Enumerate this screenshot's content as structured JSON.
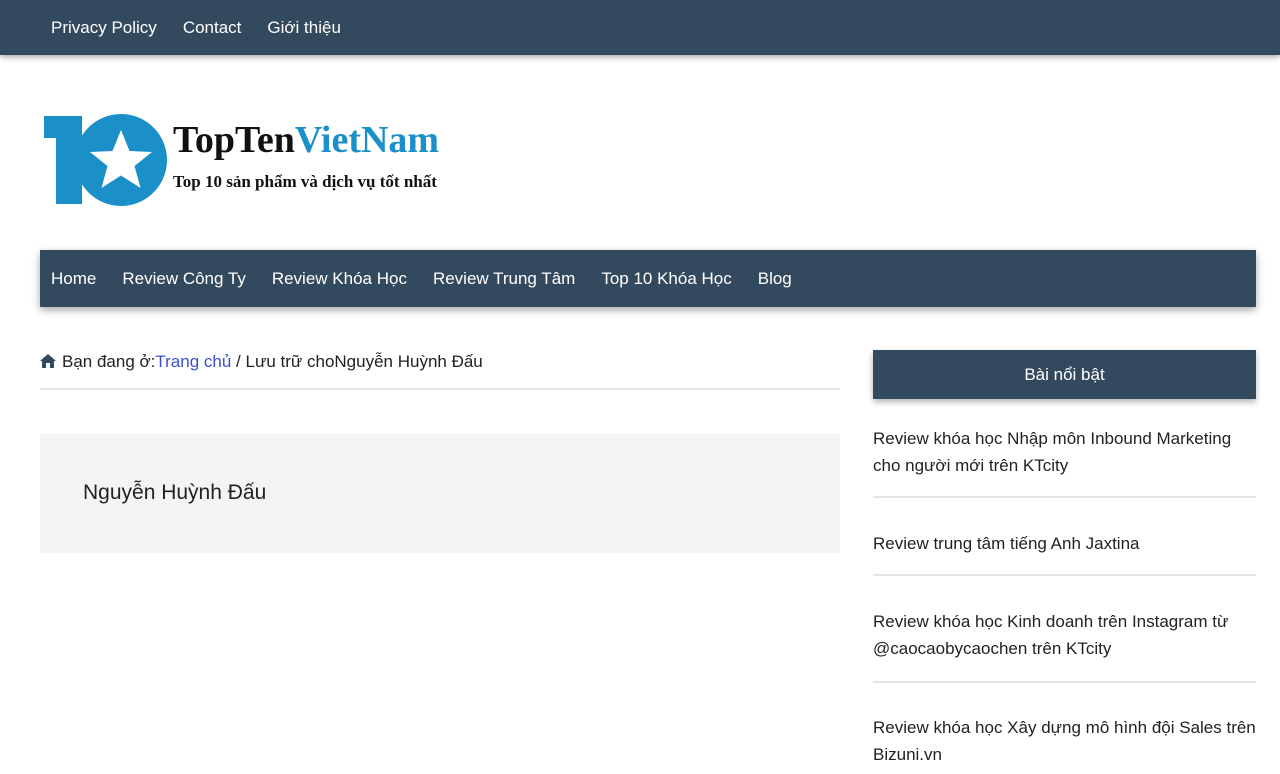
{
  "top_nav": {
    "items": [
      "Privacy Policy",
      "Contact",
      "Giới thiệu"
    ]
  },
  "logo": {
    "title_part1": "TopTen",
    "title_part2": "VietNam",
    "tagline": "Top 10 sản phẩm và dịch vụ tốt nhất",
    "colors": {
      "brand_blue": "#1b8fc8",
      "dark": "#111111"
    }
  },
  "main_nav": {
    "items": [
      "Home",
      "Review Công Ty",
      "Review Khóa Học",
      "Review Trung Tâm",
      "Top 10 Khóa Học",
      "Blog"
    ]
  },
  "breadcrumb": {
    "icon": "home-icon",
    "prefix": "Bạn đang ở:",
    "home_link": "Trang chủ",
    "separator": " / ",
    "current": "Lưu trữ choNguyễn Huỳnh Đấu"
  },
  "archive": {
    "title": "Nguyễn Huỳnh Đấu"
  },
  "sidebar": {
    "widget_title": "Bài nổi bật",
    "posts": [
      "Review khóa học Nhập môn Inbound Marketing cho người mới trên KTcity",
      "Review trung tâm tiếng Anh Jaxtina",
      "Review khóa học Kinh doanh trên Instagram từ @caocaobycaochen trên KTcity",
      "Review khóa học Xây dựng mô hình đội Sales trên Bizuni.vn"
    ]
  },
  "colors": {
    "nav_bg": "#334a5e",
    "link": "#3b4fd6",
    "archive_bg": "#f4f4f4"
  }
}
